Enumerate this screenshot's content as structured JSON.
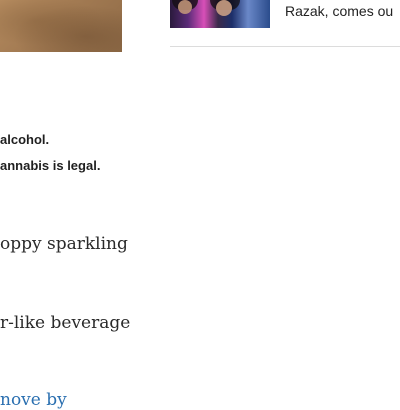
{
  "sidebar": {
    "caption_fragment": "Razak, comes ou"
  },
  "article": {
    "bold_line_1": "alcohol.",
    "bold_line_2": "annabis is legal.",
    "paragraph_1_fragment": "oppy sparkling",
    "paragraph_2_fragment": "r-like beverage",
    "link_fragment": "nove by"
  }
}
